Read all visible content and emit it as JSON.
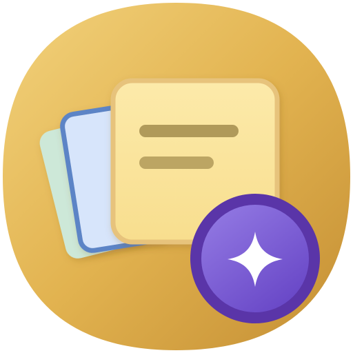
{
  "icon": {
    "name": "sticky-notes-ai-app-icon",
    "background_colors": [
      "#F2D27C",
      "#E2B350",
      "#C48E33"
    ],
    "cards": [
      {
        "name": "back-card",
        "fill": "#CDE8D8"
      },
      {
        "name": "middle-card",
        "fill": "#D7E5FB",
        "stroke": "#5C84C6"
      },
      {
        "name": "front-note",
        "fill": "#FBE7A1",
        "stroke": "#E7C37C"
      }
    ],
    "note_line_color": "#B09A5A",
    "badge": {
      "name": "sparkle-badge",
      "ring_color": "#5A35A8",
      "fill_colors": [
        "#8E74E0",
        "#6A49C8"
      ],
      "star_color": "#FFFFFF"
    }
  }
}
